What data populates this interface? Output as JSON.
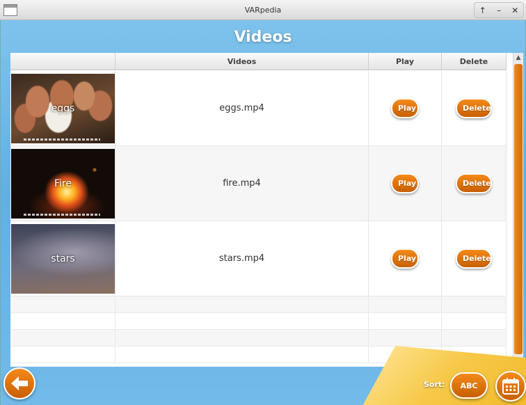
{
  "window": {
    "title": "VARpedia",
    "controls": [
      "↑",
      "–",
      "✕"
    ]
  },
  "page": {
    "heading": "Videos"
  },
  "table": {
    "columns": [
      "",
      "Videos",
      "Play",
      "Delete"
    ],
    "rows": [
      {
        "thumb_label": "eggs",
        "filename": "eggs.mp4",
        "play_label": "Play",
        "delete_label": "Delete"
      },
      {
        "thumb_label": "Fire",
        "filename": "fire.mp4",
        "play_label": "Play",
        "delete_label": "Delete"
      },
      {
        "thumb_label": "stars",
        "filename": "stars.mp4",
        "play_label": "Play",
        "delete_label": "Delete"
      }
    ]
  },
  "bottom": {
    "back_icon": "arrow-left-icon",
    "sort_label": "Sort:",
    "abc_label": "ABC",
    "calendar_icon": "calendar-icon"
  },
  "colors": {
    "accent_orange": "#e0720c",
    "background_blue": "#6cb8ea"
  }
}
